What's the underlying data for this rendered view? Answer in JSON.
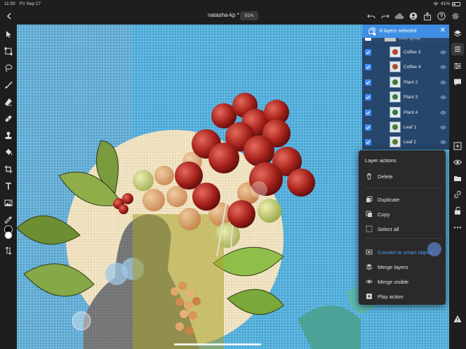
{
  "status_bar": {
    "time": "11:50",
    "date": "Fri Sep 17",
    "battery": "41%",
    "battery_level": 0.41
  },
  "top_bar": {
    "title": "natasha-kp *",
    "zoom": "91%"
  },
  "layers_panel": {
    "selected_count_label": "8 layers selected",
    "group_name": "Color group",
    "layers": [
      {
        "name": "Coffee 3"
      },
      {
        "name": "Coffee 4"
      },
      {
        "name": "Plant 2"
      },
      {
        "name": "Plant 3"
      },
      {
        "name": "Plant 4"
      },
      {
        "name": "Leaf 1"
      },
      {
        "name": "Leaf 2"
      }
    ]
  },
  "layer_actions": {
    "title": "Layer actions",
    "items": [
      {
        "label": "Delete",
        "icon": "trash-icon"
      },
      {
        "label": "Duplicate",
        "icon": "duplicate-icon"
      },
      {
        "label": "Copy",
        "icon": "copy-icon"
      },
      {
        "label": "Select all",
        "icon": "select-all-icon"
      },
      {
        "label": "Convert to smart object",
        "icon": "smart-object-icon",
        "highlighted": true
      },
      {
        "label": "Merge layers",
        "icon": "merge-layers-icon"
      },
      {
        "label": "Merge visible",
        "icon": "merge-visible-icon"
      },
      {
        "label": "Play action",
        "icon": "play-action-icon"
      }
    ]
  },
  "colors": {
    "accent": "#3f8ee3",
    "panel_selected": "#27466b",
    "canvas_sky": "#5cb7e3",
    "highlight_text": "#4c9cff"
  }
}
